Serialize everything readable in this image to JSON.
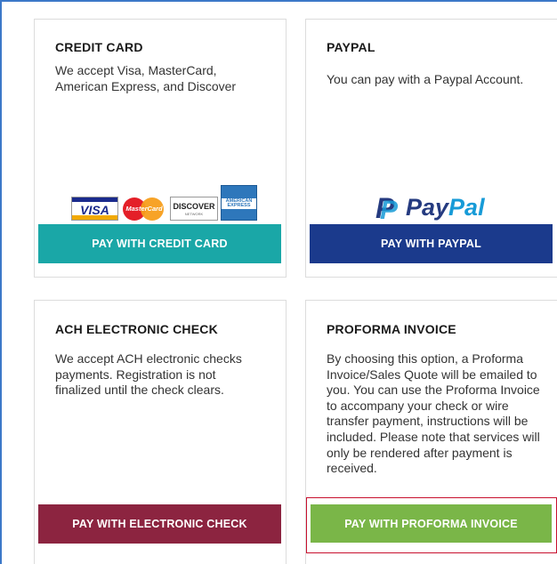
{
  "options": {
    "credit_card": {
      "title": "CREDIT CARD",
      "description": "We accept Visa, MasterCard, American Express, and Discover",
      "button_label": "PAY WITH CREDIT CARD",
      "button_color": "#1aa7a7",
      "logos": {
        "visa": "VISA",
        "mastercard": "MasterCard",
        "discover": "DISCOVER",
        "discover_sub": "NETWORK",
        "amex": "AMERICAN EXPRESS"
      }
    },
    "paypal": {
      "title": "PAYPAL",
      "description": "You can pay with a Paypal Account.",
      "button_label": "PAY WITH PAYPAL",
      "button_color": "#1b3a8c",
      "logo_word_1": "Pay",
      "logo_word_2": "Pal",
      "logo_mark": "P"
    },
    "ach": {
      "title": "ACH ELECTRONIC CHECK",
      "description": "We accept ACH electronic checks payments. Registration is not finalized until the check clears.",
      "button_label": "PAY WITH ELECTRONIC CHECK",
      "button_color": "#8c2440"
    },
    "proforma": {
      "title": "PROFORMA INVOICE",
      "description": "By choosing this option, a Proforma Invoice/Sales Quote will be emailed to you. You can use the Proforma Invoice to accompany your check or wire transfer payment, instructions will be included. Please note that services will only be rendered after payment is received.",
      "button_label": "PAY WITH PROFORMA INVOICE",
      "button_color": "#7ab648",
      "highlight_color": "#c8102e"
    }
  }
}
